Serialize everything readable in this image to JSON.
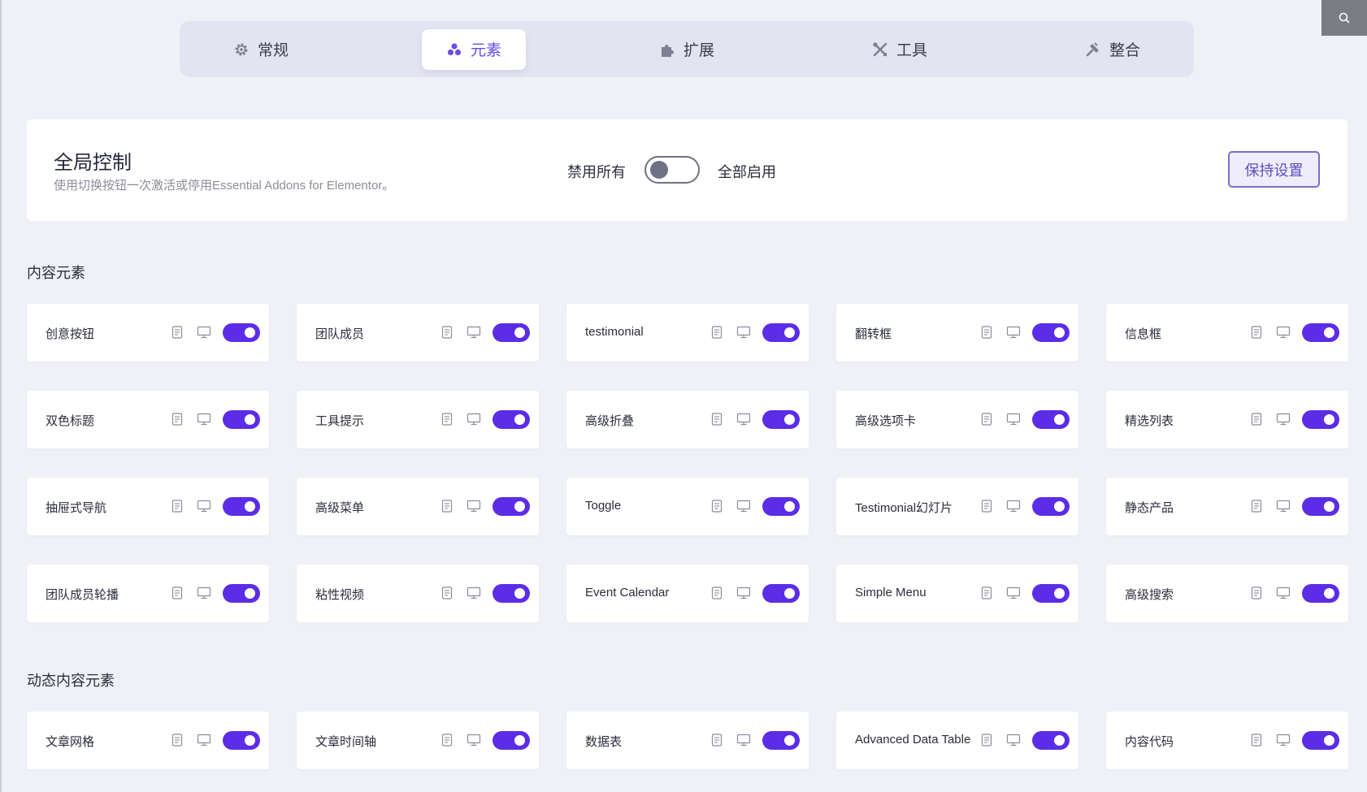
{
  "tabs": [
    {
      "label": "常规",
      "icon": "gear-icon",
      "active": false
    },
    {
      "label": "元素",
      "icon": "elements-icon",
      "active": true
    },
    {
      "label": "扩展",
      "icon": "puzzle-icon",
      "active": false
    },
    {
      "label": "工具",
      "icon": "tools-icon",
      "active": false
    },
    {
      "label": "整合",
      "icon": "plug-icon",
      "active": false
    }
  ],
  "global": {
    "title": "全局控制",
    "description": "使用切换按钮一次激活或停用Essential Addons for Elementor。",
    "disable_label": "禁用所有",
    "enable_label": "全部启用",
    "save_label": "保持设置"
  },
  "sections": [
    {
      "title": "内容元素",
      "items": [
        "创意按钮",
        "团队成员",
        "testimonial",
        "翻转框",
        "信息框",
        "双色标题",
        "工具提示",
        "高级折叠",
        "高级选项卡",
        "精选列表",
        "抽屉式导航",
        "高级菜单",
        "Toggle",
        "Testimonial幻灯片",
        "静态产品",
        "团队成员轮播",
        "粘性视频",
        "Event Calendar",
        "Simple Menu",
        "高级搜索"
      ]
    },
    {
      "title": "动态内容元素",
      "items": [
        "文章网格",
        "文章时间轴",
        "数据表",
        "Advanced Data Table",
        "内容代码"
      ]
    }
  ],
  "colors": {
    "accent": "#5b2de6",
    "active_tab_text": "#6a4ee6",
    "background": "#f0f1f7"
  }
}
